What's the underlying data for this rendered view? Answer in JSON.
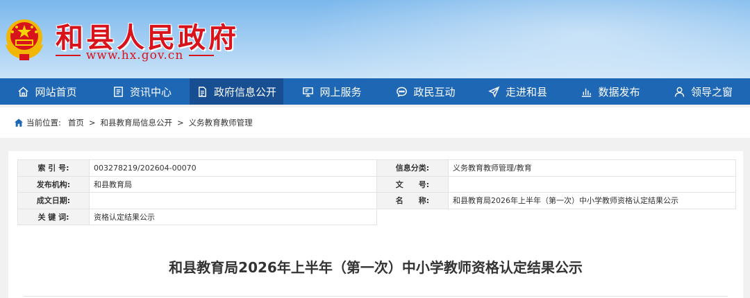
{
  "header": {
    "site_title": "和县人民政府",
    "site_url": "www.hx.gov.cn",
    "brand_red": "#d8131b",
    "nav_blue": "#1d67b5"
  },
  "nav": {
    "items": [
      {
        "label": "网站首页",
        "icon": "home-icon"
      },
      {
        "label": "资讯中心",
        "icon": "news-icon"
      },
      {
        "label": "政府信息公开",
        "icon": "document-icon"
      },
      {
        "label": "网上服务",
        "icon": "monitor-icon"
      },
      {
        "label": "政民互动",
        "icon": "chat-icon"
      },
      {
        "label": "走进和县",
        "icon": "send-icon"
      },
      {
        "label": "数据发布",
        "icon": "bar-chart-icon"
      },
      {
        "label": "领导之窗",
        "icon": "user-icon"
      }
    ],
    "active_index": 2
  },
  "breadcrumb": {
    "prefix": "当前位置:",
    "items": [
      "首页",
      "和县教育局信息公开",
      "义务教育教师管理"
    ],
    "separator": ">"
  },
  "info": {
    "index_label": "索 引 号:",
    "index_value": "003278219/202604-00070",
    "category_label": "信息分类:",
    "category_value": "义务教育教师管理/教育",
    "publisher_label": "发布机构:",
    "publisher_value": "和县教育局",
    "docno_label": "文　　号:",
    "docno_value": "",
    "date_label": "成文日期:",
    "date_value": "",
    "name_label": "名　　称:",
    "name_value": "和县教育局2026年上半年（第一次）中小学教师资格认定结果公示",
    "keywords_label": "关 键 词:",
    "keywords_value": "资格认定结果公示"
  },
  "document": {
    "title": "和县教育局2026年上半年（第一次）中小学教师资格认定结果公示"
  }
}
